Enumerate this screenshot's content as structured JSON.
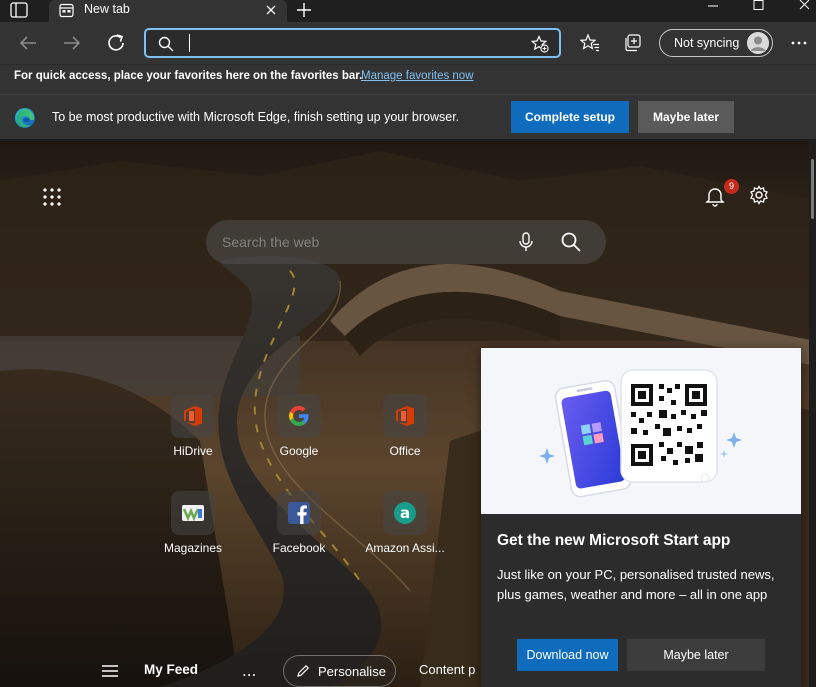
{
  "tabstrip": {
    "tab_title": "New tab"
  },
  "toolbar": {
    "address_value": "",
    "sync_label": "Not syncing"
  },
  "favorites_bar": {
    "message": "For quick access, place your favorites here on the favorites bar.",
    "link": "Manage favorites now"
  },
  "infobar": {
    "message": "To be most productive with Microsoft Edge, finish setting up your browser.",
    "complete_label": "Complete setup",
    "maybe_label": "Maybe later"
  },
  "ntp": {
    "search_placeholder": "Search the web",
    "notification_count": "9",
    "tiles": [
      {
        "label": "HiDrive",
        "icon": "office-icon"
      },
      {
        "label": "Google",
        "icon": "google-icon"
      },
      {
        "label": "Office",
        "icon": "office-icon"
      },
      {
        "label": "Magazines",
        "icon": "magazines-icon"
      },
      {
        "label": "Facebook",
        "icon": "facebook-icon"
      },
      {
        "label": "Amazon Assi...",
        "icon": "amazon-assistant-icon"
      }
    ],
    "feed": {
      "my_feed": "My Feed",
      "more": "...",
      "personalise": "Personalise",
      "content": "Content p"
    }
  },
  "promo": {
    "title": "Get the new Microsoft Start app",
    "body": "Just like on your PC, personalised trusted news, plus games, weather and more – all in one app",
    "download_label": "Download now",
    "later_label": "Maybe later"
  },
  "colors": {
    "accent": "#0f6cbd",
    "link": "#7ec0f2",
    "chrome": "#333333",
    "badge": "#c42b1c"
  }
}
